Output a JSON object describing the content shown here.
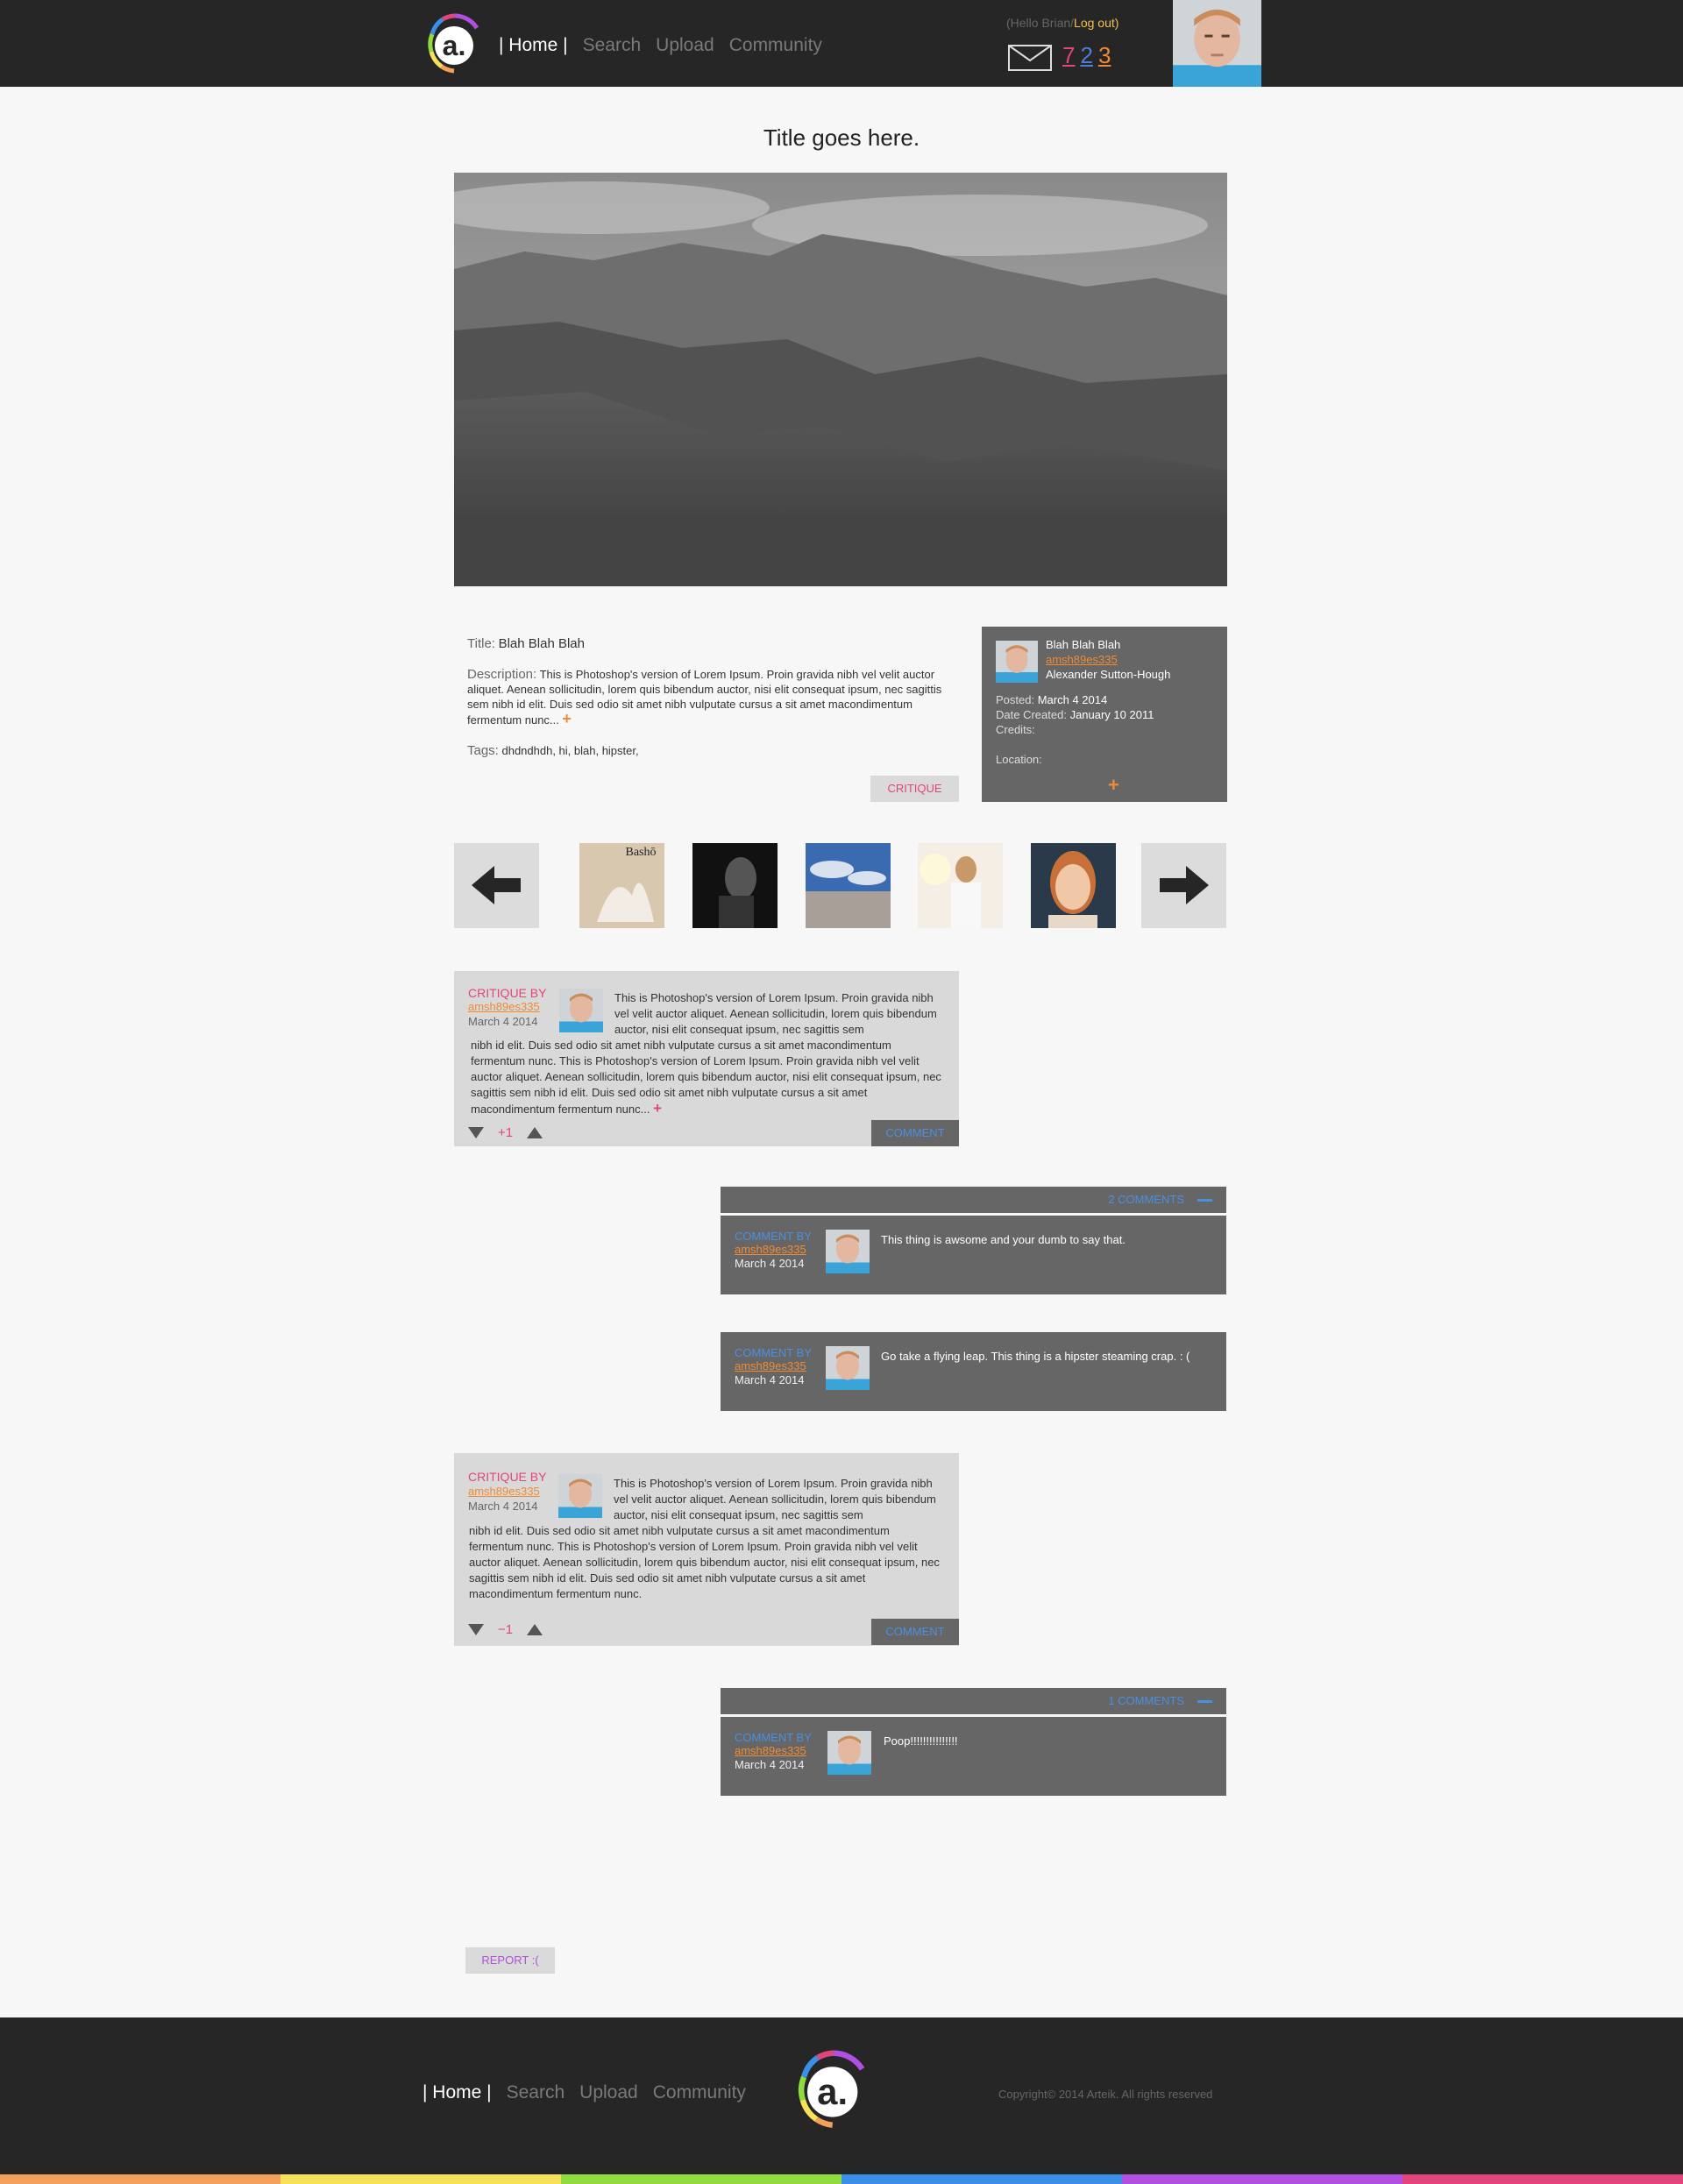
{
  "header": {
    "nav": [
      "| Home |",
      "Search",
      "Upload",
      "Community"
    ],
    "hello": "(Hello Brian/",
    "logout": "Log out)",
    "counts": [
      "7",
      "2",
      "3"
    ]
  },
  "page": {
    "title": "Title goes here."
  },
  "info": {
    "title_label": "Title:",
    "title_value": "Blah Blah Blah",
    "description_label": "Description:",
    "description_value": "This is Photoshop's version  of Lorem Ipsum. Proin gravida nibh vel velit auctor aliquet. Aenean sollicitudin, lorem quis bibendum auctor, nisi elit consequat ipsum, nec sagittis sem nibh id elit. Duis sed odio sit amet nibh vulputate cursus a sit amet macondimentum fermentum nunc...",
    "more": "+",
    "tags_label": "Tags:",
    "tags_value": "dhdndhdh, hi, blah, hipster,",
    "critique_button": "CRITIQUE"
  },
  "author": {
    "name_line": "Blah Blah Blah",
    "username": "amsh89es335",
    "full_name": "Alexander Sutton-Hough",
    "posted_label": "Posted:",
    "posted_value": "March 4 2014",
    "created_label": "Date Created:",
    "created_value": "January 10 2011",
    "credits_label": "Credits:",
    "location_label": "Location:",
    "more": "+"
  },
  "critiques": [
    {
      "by": "CRITIQUE BY",
      "username": "amsh89es335",
      "date": "March 4 2014",
      "body_indented": "This is Photoshop's version  of Lorem Ipsum. Proin gravida nibh vel velit auctor aliquet. Aenean sollicitudin, lorem quis bibendum auctor, nisi elit consequat ipsum, nec sagittis sem",
      "body_full": "nibh id elit. Duis sed odio sit amet nibh vulputate cursus a sit amet macondimentum fermentum nunc. This is Photoshop's version  of Lorem Ipsum. Proin gravida nibh vel velit auctor aliquet. Aenean sollicitudin, lorem quis bibendum auctor, nisi elit consequat ipsum, nec sagittis sem nibh id elit. Duis sed odio sit amet nibh vulputate cursus a sit amet macondimentum fermentum nunc...",
      "more": "+",
      "score": "+1",
      "comment_button": "COMMENT",
      "comments_label": "2 COMMENTS",
      "comments": [
        {
          "by": "COMMENT BY",
          "username": "amsh89es335",
          "date": "March 4 2014",
          "text": "This thing is awsome and your dumb to say that."
        },
        {
          "by": "COMMENT BY",
          "username": "amsh89es335",
          "date": "March 4 2014",
          "text": "Go take a flying leap. This thing is a hipster steaming crap. : ("
        }
      ]
    },
    {
      "by": "CRITIQUE BY",
      "username": "amsh89es335",
      "date": "March 4 2014",
      "body_indented": "This is Photoshop's version  of Lorem Ipsum. Proin gravida nibh vel velit auctor aliquet. Aenean sollicitudin, lorem quis bibendum auctor, nisi elit consequat ipsum, nec sagittis sem",
      "body_full": "nibh id elit. Duis sed odio sit amet nibh vulputate cursus a sit amet macondimentum fermentum nunc. This is Photoshop's version  of Lorem Ipsum. Proin gravida nibh vel velit auctor aliquet. Aenean sollicitudin, lorem quis bibendum auctor, nisi elit consequat ipsum, nec sagittis sem nibh id elit. Duis sed odio sit amet nibh vulputate cursus a sit amet macondimentum fermentum nunc.",
      "score": "−1",
      "comment_button": "COMMENT",
      "comments_label": "1 COMMENTS",
      "comments": [
        {
          "by": "COMMENT BY",
          "username": "amsh89es335",
          "date": "March 4 2014",
          "text": "Poop!!!!!!!!!!!!!!!"
        }
      ]
    }
  ],
  "report_button": "REPORT :(",
  "footer": {
    "nav": [
      "| Home |",
      "Search",
      "Upload",
      "Community"
    ],
    "copyright": "Copyright© 2014 Arteik. All rights reserved"
  },
  "theme": {
    "dark": "#262626",
    "accent_pink": "#e0457b",
    "accent_blue": "#4a8fe0",
    "accent_orange": "#f08a34",
    "accent_yellow": "#f2c14e",
    "stripe_colors": [
      "#f5a05a",
      "#f6e25a",
      "#8fdc3c",
      "#3c8fe8",
      "#b04fe0",
      "#e0457b"
    ]
  },
  "icons": [
    "logo-icon",
    "mail-icon",
    "arrow-left-icon",
    "arrow-right-icon",
    "vote-down-icon",
    "vote-up-icon",
    "collapse-minus-icon"
  ]
}
